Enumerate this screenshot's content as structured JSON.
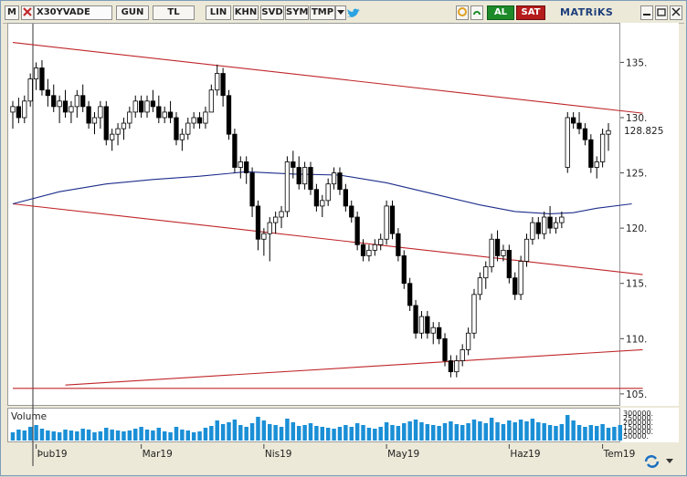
{
  "toolbar": {
    "menu_label": "M",
    "symbol": "X30YVADE",
    "period": "GUN",
    "currency": "TL",
    "scale": "LIN",
    "b1": "KHN",
    "b2": "SVD",
    "b3": "SYM",
    "b4": "TMP",
    "buy": "AL",
    "sell": "SAT",
    "brand": "MATRiKS",
    "icons": [
      "menu-icon",
      "clear-icon",
      "dropdown-icon",
      "twitter-icon",
      "refresh-icon",
      "link-icon",
      "minimize-icon",
      "restore-icon",
      "close-icon"
    ]
  },
  "colors": {
    "bull": "#ffffff",
    "bear": "#000000",
    "trend": "#c0262a",
    "ma": "#1c2d8c",
    "volume": "#1a8fd6"
  },
  "chart_data": {
    "type": "candlestick",
    "title": "",
    "ylim": [
      104,
      138.5
    ],
    "y_ticks": [
      "135.",
      "130.",
      "125.",
      "120.",
      "115.",
      "110.",
      "105."
    ],
    "last_price_label": "128.825",
    "x_tick_labels": [
      "Þub19",
      "Mar19",
      "Nis19",
      "May19",
      "Haz19",
      "Tem19"
    ],
    "candles": [
      [
        130.5,
        131.5,
        129,
        131
      ],
      [
        131,
        131.8,
        129.5,
        130
      ],
      [
        130,
        132,
        129.5,
        131.5
      ],
      [
        131.5,
        134,
        131,
        133.5
      ],
      [
        133.5,
        135,
        132.5,
        134.5
      ],
      [
        134.5,
        135.2,
        132,
        132.5
      ],
      [
        132.5,
        133.5,
        131,
        132
      ],
      [
        132,
        133,
        130.5,
        131
      ],
      [
        131,
        132,
        129.5,
        131.5
      ],
      [
        131.5,
        132.5,
        130,
        130.5
      ],
      [
        130.5,
        131.5,
        129.5,
        131
      ],
      [
        131,
        132.5,
        130,
        132
      ],
      [
        132,
        133,
        130.5,
        131
      ],
      [
        131,
        131.5,
        129,
        129.5
      ],
      [
        129.5,
        130.5,
        128.5,
        130
      ],
      [
        130,
        131.5,
        129,
        131
      ],
      [
        131,
        131.5,
        127.5,
        128
      ],
      [
        128,
        129,
        127,
        128.5
      ],
      [
        128.5,
        129.5,
        127.5,
        129
      ],
      [
        129,
        130,
        128,
        129.5
      ],
      [
        129.5,
        131,
        129,
        130.5
      ],
      [
        130.5,
        132,
        130,
        131.5
      ],
      [
        131.5,
        132,
        130,
        130.5
      ],
      [
        130.5,
        132,
        130,
        131.5
      ],
      [
        131.5,
        132.5,
        130.5,
        131
      ],
      [
        131,
        132,
        129.5,
        130
      ],
      [
        130,
        131,
        129.5,
        130.5
      ],
      [
        130.5,
        131.5,
        129.5,
        130
      ],
      [
        130,
        130.5,
        127.5,
        128
      ],
      [
        128,
        129,
        127,
        128.5
      ],
      [
        128.5,
        130,
        128,
        129.5
      ],
      [
        129.5,
        130.5,
        129,
        130
      ],
      [
        130,
        130.5,
        129,
        129.5
      ],
      [
        129.5,
        131,
        129,
        130.5
      ],
      [
        130.5,
        133,
        130.5,
        132.5
      ],
      [
        132.5,
        134.8,
        132,
        134
      ],
      [
        134,
        134.5,
        131,
        132
      ],
      [
        132,
        132.5,
        128,
        128.5
      ],
      [
        128.5,
        129,
        125,
        125.5
      ],
      [
        125.5,
        126.5,
        124.5,
        126
      ],
      [
        126,
        126.5,
        124,
        125
      ],
      [
        125,
        125.5,
        121,
        122
      ],
      [
        122,
        122.5,
        118,
        119
      ],
      [
        119,
        120,
        117.5,
        119.5
      ],
      [
        119.5,
        121,
        117,
        120.5
      ],
      [
        120.5,
        121.5,
        119.5,
        121
      ],
      [
        121,
        122,
        120,
        121.5
      ],
      [
        121.5,
        126.5,
        121,
        126
      ],
      [
        126,
        127,
        124.5,
        125.5
      ],
      [
        125.5,
        126.5,
        123.5,
        124
      ],
      [
        124,
        126,
        123.5,
        125.5
      ],
      [
        125.5,
        126,
        123,
        123.5
      ],
      [
        123.5,
        124,
        121.5,
        122
      ],
      [
        122,
        123,
        121,
        122.5
      ],
      [
        122.5,
        124.5,
        122,
        124
      ],
      [
        124,
        125.5,
        123.5,
        125
      ],
      [
        125,
        125.5,
        123,
        123.5
      ],
      [
        123.5,
        124,
        121.5,
        122
      ],
      [
        122,
        122.5,
        120.5,
        121
      ],
      [
        121,
        121.5,
        118,
        118.5
      ],
      [
        118.5,
        119,
        117,
        117.5
      ],
      [
        117.5,
        118.5,
        117,
        118
      ],
      [
        118,
        119,
        117.5,
        118.5
      ],
      [
        118.5,
        119.5,
        118,
        119
      ],
      [
        119,
        122.5,
        118.5,
        122
      ],
      [
        122,
        122.5,
        119,
        119.5
      ],
      [
        119.5,
        120,
        117,
        117.5
      ],
      [
        117.5,
        118,
        114.5,
        115
      ],
      [
        115,
        115.5,
        112.5,
        113
      ],
      [
        113,
        113.5,
        110,
        110.5
      ],
      [
        110.5,
        112.5,
        110,
        112
      ],
      [
        112,
        112.5,
        110,
        110.5
      ],
      [
        110.5,
        111.5,
        109.5,
        111
      ],
      [
        111,
        111.5,
        109.5,
        110
      ],
      [
        110,
        110.5,
        107.5,
        108
      ],
      [
        108,
        108.5,
        106.5,
        107
      ],
      [
        107,
        108.5,
        106.5,
        108
      ],
      [
        108,
        109.5,
        107.5,
        109
      ],
      [
        109,
        111,
        108.5,
        110.5
      ],
      [
        110.5,
        114.5,
        110,
        114
      ],
      [
        114,
        116,
        113.5,
        115.5
      ],
      [
        115.5,
        117,
        114.5,
        116.5
      ],
      [
        116.5,
        119.5,
        116,
        119
      ],
      [
        119,
        119.8,
        117,
        117.5
      ],
      [
        117.5,
        118.5,
        117,
        118
      ],
      [
        118,
        118.5,
        115,
        115.5
      ],
      [
        115.5,
        116,
        113.5,
        114
      ],
      [
        114,
        117.5,
        113.5,
        117
      ],
      [
        117,
        119.5,
        116.5,
        119
      ],
      [
        119,
        121,
        118.5,
        120.5
      ],
      [
        120.5,
        121,
        119,
        119.5
      ],
      [
        119.5,
        121.5,
        119,
        121
      ],
      [
        121,
        122,
        119.5,
        120
      ],
      [
        120,
        121,
        119.5,
        120.5
      ],
      [
        120.5,
        121.5,
        120,
        121
      ],
      [
        125.5,
        130.5,
        125,
        130
      ],
      [
        130,
        130.5,
        129,
        129.5
      ],
      [
        129.5,
        130.5,
        128.5,
        129
      ],
      [
        129,
        129.5,
        127.5,
        128
      ],
      [
        128,
        128.5,
        125,
        125.5
      ],
      [
        125.5,
        126.5,
        124.5,
        126
      ],
      [
        126,
        129,
        125.5,
        128.5
      ],
      [
        128.5,
        129.5,
        127,
        128.825
      ]
    ],
    "moving_average": [
      [
        0,
        122.2
      ],
      [
        8,
        123.3
      ],
      [
        16,
        124.0
      ],
      [
        24,
        124.4
      ],
      [
        32,
        124.7
      ],
      [
        40,
        125.1
      ],
      [
        48,
        124.9
      ],
      [
        56,
        124.8
      ],
      [
        64,
        124.1
      ],
      [
        72,
        123.1
      ],
      [
        80,
        122.1
      ],
      [
        86,
        121.5
      ],
      [
        92,
        121.3
      ],
      [
        96,
        121.4
      ],
      [
        100,
        121.8
      ],
      [
        106,
        122.2
      ]
    ],
    "trendlines": [
      {
        "name": "upper",
        "from": [
          0,
          136.8
        ],
        "to": [
          106,
          130.4
        ]
      },
      {
        "name": "middle",
        "from": [
          0,
          122.2
        ],
        "to": [
          106,
          115.8
        ]
      },
      {
        "name": "lower",
        "from": [
          9,
          105.8
        ],
        "to": [
          106,
          109.0
        ]
      },
      {
        "name": "base",
        "from": [
          0,
          105.5
        ],
        "to": [
          106,
          105.5
        ]
      }
    ],
    "volume": {
      "label": "Volume",
      "axis_labels": [
        "300000.",
        "250000.",
        "200000.",
        "150000.",
        "100000.",
        "50000."
      ],
      "ylim": [
        0,
        320000
      ],
      "values": [
        90000,
        120000,
        110000,
        150000,
        170000,
        130000,
        110000,
        100000,
        90000,
        120000,
        110000,
        100000,
        130000,
        120000,
        90000,
        100000,
        140000,
        120000,
        110000,
        100000,
        110000,
        130000,
        150000,
        120000,
        110000,
        140000,
        100000,
        90000,
        150000,
        120000,
        110000,
        90000,
        100000,
        140000,
        160000,
        220000,
        180000,
        200000,
        230000,
        170000,
        150000,
        190000,
        260000,
        220000,
        180000,
        170000,
        150000,
        240000,
        200000,
        160000,
        170000,
        190000,
        160000,
        150000,
        140000,
        130000,
        150000,
        170000,
        150000,
        190000,
        170000,
        140000,
        130000,
        150000,
        200000,
        170000,
        160000,
        190000,
        210000,
        230000,
        200000,
        180000,
        170000,
        160000,
        190000,
        210000,
        180000,
        170000,
        190000,
        230000,
        210000,
        190000,
        250000,
        200000,
        180000,
        220000,
        200000,
        230000,
        210000,
        240000,
        200000,
        190000,
        170000,
        160000,
        180000,
        280000,
        220000,
        170000,
        150000,
        170000,
        160000,
        180000,
        140000,
        150000,
        170000
      ]
    }
  }
}
